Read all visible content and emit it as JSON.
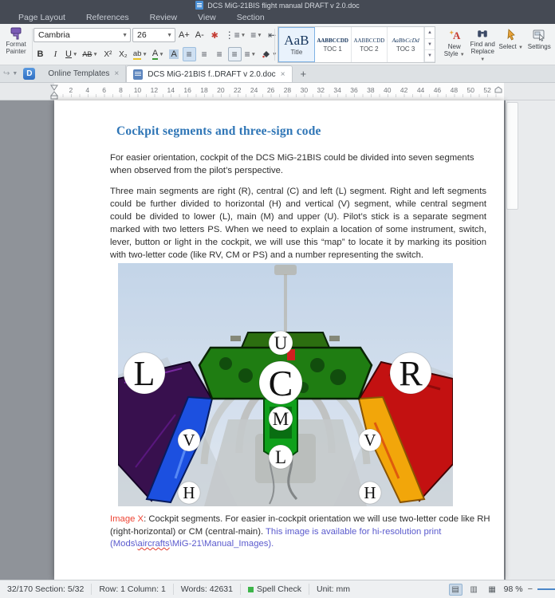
{
  "window": {
    "title": "DCS MiG-21BIS flight manual DRAFT v 2.0.doc"
  },
  "menu": {
    "items": [
      "Page Layout",
      "References",
      "Review",
      "View",
      "Section"
    ]
  },
  "toolbar": {
    "format_painter": "Format Painter",
    "font_name": "Cambria",
    "font_size": "26",
    "glyphs": {
      "grow": "A+",
      "shrink": "A-",
      "effects": "✱",
      "bullets": "⋮≡",
      "numbering": "≡",
      "outdent": "⇤",
      "indent": "⇥",
      "charscale": "A",
      "table": "⊞",
      "pilcrow": "¶",
      "showmarks": "⊡",
      "bold": "B",
      "italic": "I",
      "underline": "U",
      "strike": "AB",
      "superscript": "X²",
      "subscript": "X₂",
      "highlight": "ab",
      "font_color": "A",
      "char_shading": "A",
      "align_left": "≡",
      "align_center": "≡",
      "align_right": "≡",
      "justify": "≡",
      "distributed": "≡",
      "line_spacing": "≡",
      "borders": "⊞"
    }
  },
  "styles_gallery": {
    "items": [
      {
        "preview": "AaB",
        "label": "Title"
      },
      {
        "preview": "AABBCCDD",
        "label": "TOC 1"
      },
      {
        "preview": "AABBCCDD",
        "label": "TOC 2"
      },
      {
        "preview": "AaBbCcDd",
        "label": "TOC 3"
      }
    ]
  },
  "right_tools": {
    "new_style": "New Style",
    "find_replace": "Find and Replace",
    "select": "Select",
    "settings": "Settings"
  },
  "tab_bar": {
    "home_tab": "Online Templates",
    "doc_tab": "DCS MiG-21BIS f..DRAFT v 2.0.doc",
    "new_tab": "+"
  },
  "ruler": {
    "numbers": [
      2,
      4,
      6,
      8,
      10,
      12,
      14,
      16,
      18,
      20,
      22,
      24,
      26,
      28,
      30,
      32,
      34,
      36,
      38,
      40,
      42,
      44,
      46,
      48,
      50,
      52
    ]
  },
  "document": {
    "heading": "Cockpit segments and three-sign code",
    "para1": "For easier orientation, cockpit of the DCS MiG-21BIS could be divided into seven segments when observed from the pilot’s perspective.",
    "para2": "Three main segments are right (R), central (C) and left (L) segment. Right and left segments could be further divided to horizontal (H) and vertical (V) segment, while central segment could be divided to lower (L), main (M) and upper (U). Pilot’s stick is a separate segment marked with two letters PS. When we need to explain a location of some instrument, switch, lever, button or light in the cockpit, we will use this “map” to locate it by marking its position with two-letter code (like RV, CM or PS) and a number representing the switch.",
    "caption": {
      "label": "Image X",
      "body": ": Cockpit segments. For easier in-cockpit orientation we will use two-letter code like RH (right-horizontal) or CM (central-main). ",
      "note_pre": "This image is available for hi-resolution print (Mods\\",
      "path_word": "aircrafts",
      "note_post": "\\MiG-21\\Manual_Images)."
    },
    "segments": {
      "left": "L",
      "right": "R",
      "upper": "U",
      "central": "C",
      "main": "M",
      "lower": "L",
      "left_v": "V",
      "left_h": "H",
      "right_v": "V",
      "right_h": "H"
    }
  },
  "status_bar": {
    "pages": "32/170 Section: 5/32",
    "row_col": "Row: 1 Column: 1",
    "words": "Words: 42631",
    "spell": "Spell Check",
    "unit": "Unit: mm",
    "zoom": "98 %"
  }
}
